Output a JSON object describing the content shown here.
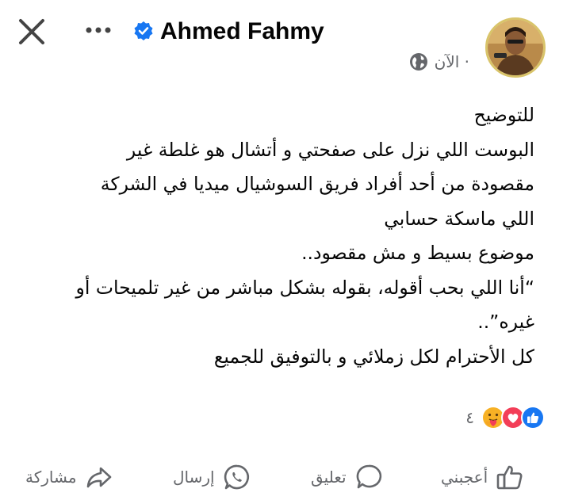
{
  "header": {
    "author_name": "Ahmed Fahmy",
    "timestamp": "الآن ·",
    "privacy_icon": "globe-icon",
    "verified_icon": "verified-badge-icon",
    "close_icon": "close-icon",
    "more_icon": "more-icon"
  },
  "post": {
    "lines": [
      "للتوضيح",
      "البوست اللي نزل على صفحتي و أتشال هو غلطة غير",
      "مقصودة من أحد أفراد فريق السوشيال ميديا في الشركة",
      "اللي ماسكة حسابي",
      "موضوع بسيط و مش مقصود..",
      "“أنا اللي بحب أقوله، بقوله بشكل مباشر من غير تلميحات أو",
      "غيره”..",
      "كل الأحترام لكل زملائي و بالتوفيق للجميع"
    ]
  },
  "reactions": {
    "count": "٤",
    "icons": [
      "like-reaction-icon",
      "love-reaction-icon",
      "care-reaction-icon"
    ]
  },
  "actions": {
    "like": "أعجبني",
    "comment": "تعليق",
    "send": "إرسال",
    "share": "مشاركة"
  },
  "colors": {
    "verified": "#1877f2",
    "like": "#1877f2",
    "love": "#f33e58",
    "care": "#f7b125",
    "secondary_text": "#65676b"
  }
}
